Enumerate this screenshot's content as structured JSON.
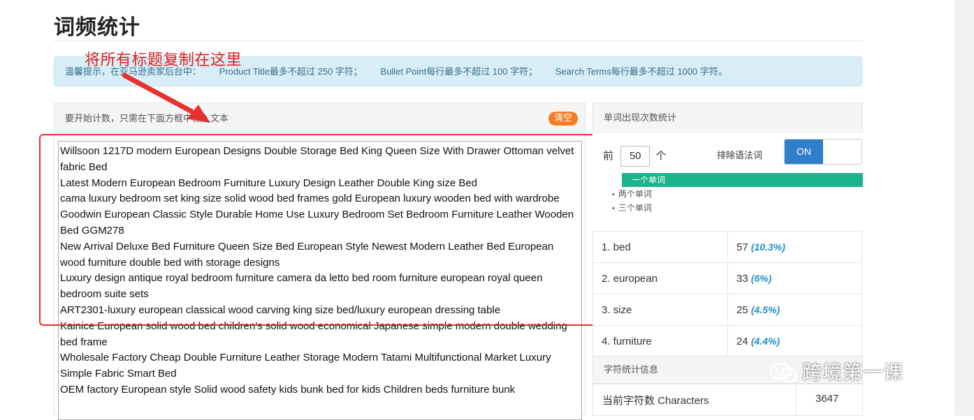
{
  "page_title": "词频统计",
  "annotation": "将所有标题复制在这里",
  "notice": {
    "prefix": "温馨提示，在亚马逊卖家后台中：",
    "title_rule": "Product Title最多不超过 250 字符；",
    "bullet_rule": "Bullet Point每行最多不超过 100 字符；",
    "search_rule": "Search Terms每行最多不超过 1000 字符。"
  },
  "input_panel": {
    "header": "要开始计数，只需在下面方框中输入文本",
    "clear_label": "清空",
    "lines": [
      "Willsoon 1217D modern European Designs Double Storage Bed King Queen Size With Drawer Ottoman velvet fabric Bed",
      "Latest Modern European Bedroom Furniture Luxury Design Leather Double King size Bed",
      "cama luxury bedroom set king size solid wood bed frames gold European luxury wooden bed with wardrobe",
      "Goodwin European Classic Style Durable Home Use Luxury Bedroom Set Bedroom Furniture Leather Wooden Bed GGM278",
      "New Arrival Deluxe Bed Furniture Queen Size Bed European Style Newest Modern Leather Bed European wood furniture double bed with storage designs",
      "Luxury design antique royal bedroom furniture camera da letto bed room furniture european royal queen bedroom suite sets",
      "ART2301-luxury european classical wood carving king size bed/luxury european dressing table",
      "Kainice European solid wood bed children's solid wood economical Japanese simple modern double wedding bed frame",
      "Wholesale Factory Cheap Double Furniture Leather Storage Modern Tatami Multifunctional Market Luxury Simple Fabric Smart Bed",
      "OEM factory European style Solid wood safety kids bunk bed for kids Children beds furniture bunk"
    ]
  },
  "freq_panel": {
    "header": "单词出现次数统计",
    "top_prefix": "前",
    "top_n": "50",
    "top_suffix": "个",
    "exclude_label": "排除语法词",
    "toggle_label": "ON",
    "gram_options": [
      "一个单词",
      "两个单词",
      "三个单词"
    ],
    "rows": [
      {
        "word": "1. bed",
        "count": "57",
        "pct": "(10.3%)"
      },
      {
        "word": "2. european",
        "count": "33",
        "pct": "(6%)"
      },
      {
        "word": "3. size",
        "count": "25",
        "pct": "(4.5%)"
      },
      {
        "word": "4. furniture",
        "count": "24",
        "pct": "(4.4%)"
      }
    ]
  },
  "stats_panel": {
    "header": "字符统计信息",
    "char_label": "当前字符数 Characters",
    "char_value": "3647"
  },
  "watermark": "跨境第一课",
  "colors": {
    "accent_blue": "#2f7fcb",
    "active_green": "#1db48a",
    "clear_orange": "#f57c22",
    "annotation_red": "#e8302c",
    "notice_bg": "#d9edf7",
    "pct_blue": "#1e90c8"
  }
}
